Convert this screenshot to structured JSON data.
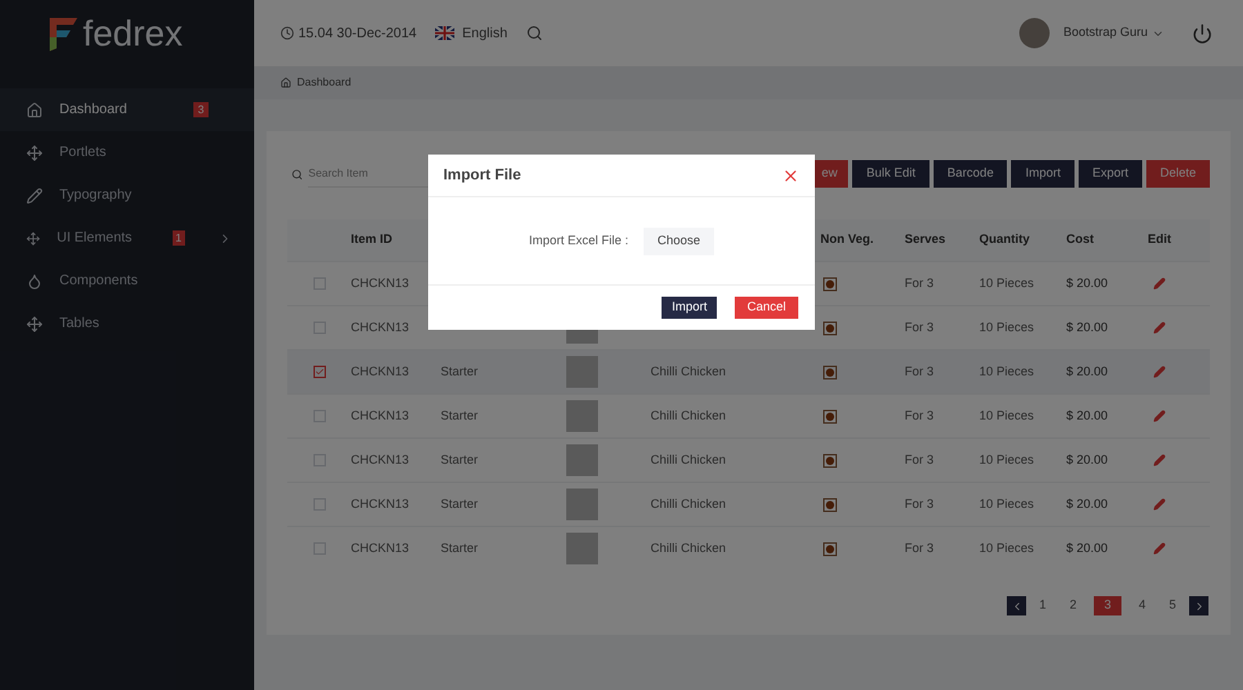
{
  "logo": {
    "text": "fedrex"
  },
  "header": {
    "datetime": "15.04 30-Dec-2014",
    "language": "English",
    "user": "Bootstrap Guru"
  },
  "sidebar": {
    "items": [
      {
        "label": "Dashboard",
        "selected": true,
        "badge": "3"
      },
      {
        "label": "Portlets",
        "selected": false
      },
      {
        "label": "Typography",
        "selected": false
      },
      {
        "label": "UI Elements",
        "selected": false,
        "badge": "1",
        "submenu": true
      },
      {
        "label": "Components",
        "selected": false
      },
      {
        "label": "Tables",
        "selected": false
      }
    ]
  },
  "breadcrumb": {
    "label": "Dashboard"
  },
  "toolbar": {
    "search": {
      "placeholder": "Search Item"
    },
    "buttons": [
      {
        "label": "ew",
        "kind": "danger"
      },
      {
        "label": "Bulk Edit",
        "kind": "dark"
      },
      {
        "label": "Barcode",
        "kind": "dark"
      },
      {
        "label": "Import",
        "kind": "dark"
      },
      {
        "label": "Export",
        "kind": "dark"
      },
      {
        "label": "Delete",
        "kind": "danger"
      }
    ]
  },
  "table": {
    "columns": [
      "Item ID",
      "Non Veg.",
      "Serves",
      "Quantity",
      "Cost",
      "Edit"
    ],
    "rows": [
      {
        "checked": false,
        "item_id": "CHCKN13",
        "serves": "For 3",
        "quantity": "10 Pieces",
        "cost": "$ 20.00"
      },
      {
        "checked": false,
        "item_id": "CHCKN13",
        "serves": "For 3",
        "quantity": "10 Pieces",
        "cost": "$ 20.00"
      },
      {
        "checked": true,
        "item_id": "CHCKN13",
        "category": "Starter",
        "name": "Chilli Chicken",
        "serves": "For 3",
        "quantity": "10 Pieces",
        "cost": "$ 20.00"
      },
      {
        "checked": false,
        "item_id": "CHCKN13",
        "category": "Starter",
        "name": "Chilli Chicken",
        "serves": "For 3",
        "quantity": "10 Pieces",
        "cost": "$ 20.00"
      },
      {
        "checked": false,
        "item_id": "CHCKN13",
        "category": "Starter",
        "name": "Chilli Chicken",
        "serves": "For 3",
        "quantity": "10 Pieces",
        "cost": "$ 20.00"
      },
      {
        "checked": false,
        "item_id": "CHCKN13",
        "category": "Starter",
        "name": "Chilli Chicken",
        "serves": "For 3",
        "quantity": "10 Pieces",
        "cost": "$ 20.00"
      },
      {
        "checked": false,
        "item_id": "CHCKN13",
        "category": "Starter",
        "name": "Chilli Chicken",
        "serves": "For 3",
        "quantity": "10 Pieces",
        "cost": "$ 20.00"
      }
    ]
  },
  "pagination": {
    "pages": [
      {
        "label": "1",
        "selected": false
      },
      {
        "label": "2",
        "selected": false
      },
      {
        "label": "3",
        "selected": true
      },
      {
        "label": "4",
        "selected": false
      },
      {
        "label": "5",
        "selected": false
      }
    ]
  },
  "modal": {
    "title": "Import File",
    "field_label": "Import Excel File :",
    "choose": "Choose",
    "buttons": [
      {
        "label": "Import",
        "kind": "dark"
      },
      {
        "label": "Cancel",
        "kind": "danger"
      }
    ]
  }
}
